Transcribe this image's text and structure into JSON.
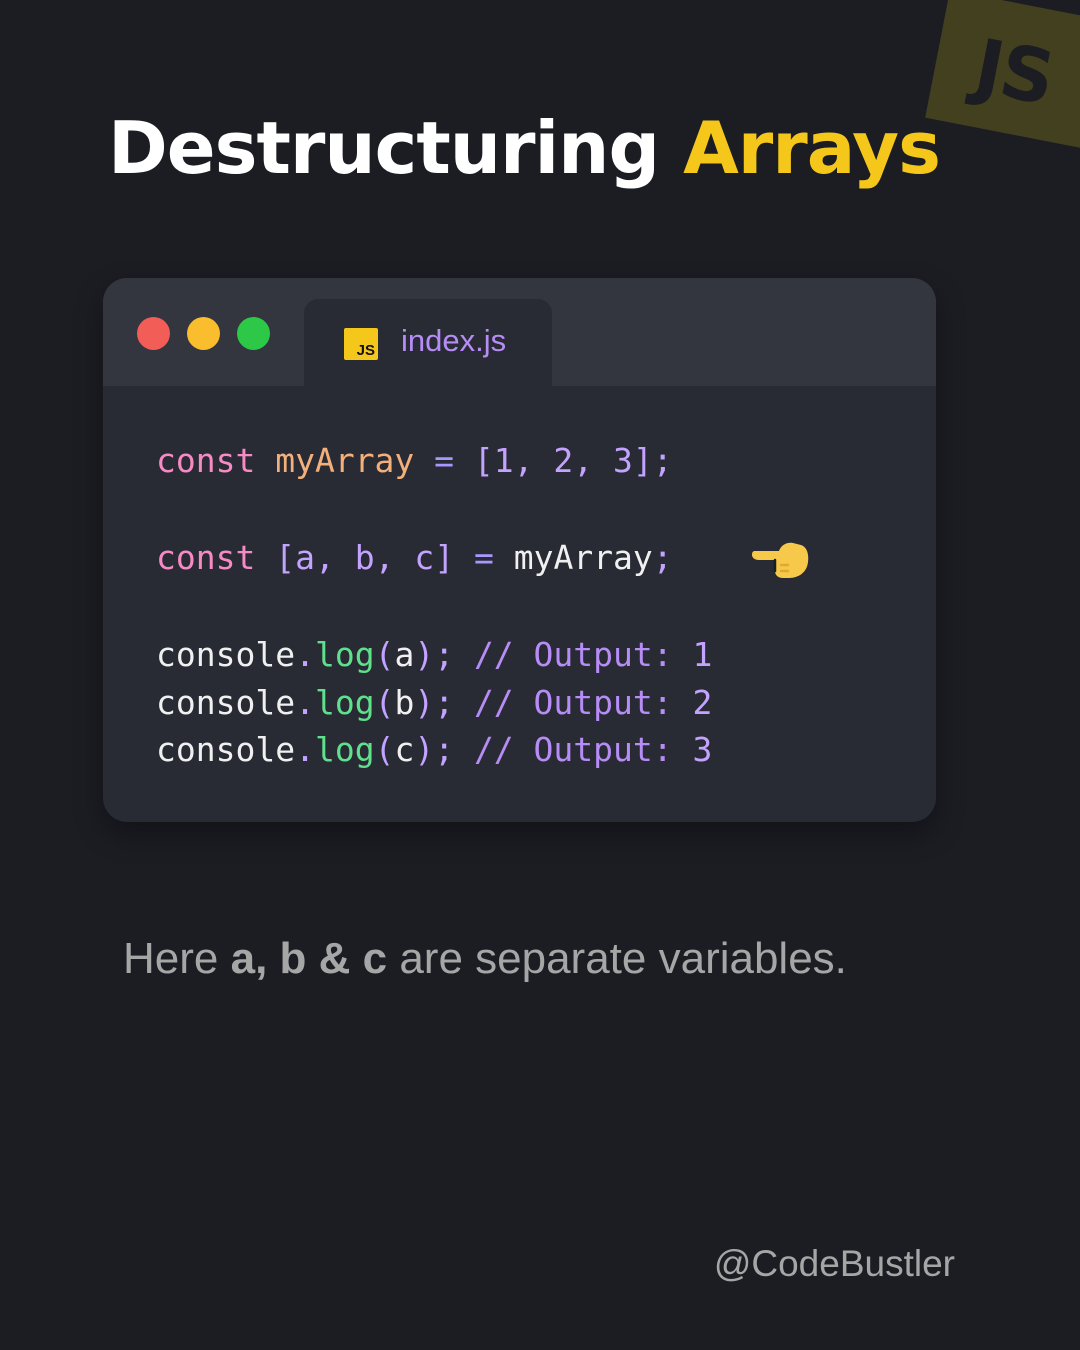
{
  "corner_badge": {
    "text": "JS"
  },
  "title": {
    "part1": "Destructuring",
    "part2": "Arrays"
  },
  "colors": {
    "background": "#1b1d23",
    "accent": "#f6c71b",
    "editor_bg": "#282a34",
    "editor_header": "#33353f",
    "keyword": "#f58ac5",
    "variable": "#f4b07a",
    "function": "#5fe08c",
    "comment": "#b68cf5"
  },
  "editor": {
    "window_controls": [
      "close",
      "minimize",
      "maximize"
    ],
    "tab": {
      "icon_text": "JS",
      "filename": "index.js"
    },
    "code": {
      "line1": {
        "kw": "const",
        "var": "myArray",
        "op": "=",
        "open": "[",
        "n1": "1",
        "n2": "2",
        "n3": "3",
        "close": "]",
        "end": ";"
      },
      "line2": {
        "kw": "const",
        "open": "[",
        "a": "a",
        "b": "b",
        "c": "c",
        "close": "]",
        "op": "=",
        "rhs": "myArray",
        "end": ";",
        "icon": "pointing-left-hand-icon"
      },
      "log_lines": [
        {
          "obj": "console",
          "dot": ".",
          "fn": "log",
          "paren_open": "(",
          "arg": "a",
          "paren_close": ")",
          "semi": ";",
          "comment": "// Output:",
          "value": "1"
        },
        {
          "obj": "console",
          "dot": ".",
          "fn": "log",
          "paren_open": "(",
          "arg": "b",
          "paren_close": ")",
          "semi": ";",
          "comment": "// Output:",
          "value": "2"
        },
        {
          "obj": "console",
          "dot": ".",
          "fn": "log",
          "paren_open": "(",
          "arg": "c",
          "paren_close": ")",
          "semi": ";",
          "comment": "// Output:",
          "value": "3"
        }
      ]
    }
  },
  "caption": {
    "before": "Here ",
    "bold": "a, b & c",
    "after": " are separate variables."
  },
  "handle": "@CodeBustler"
}
